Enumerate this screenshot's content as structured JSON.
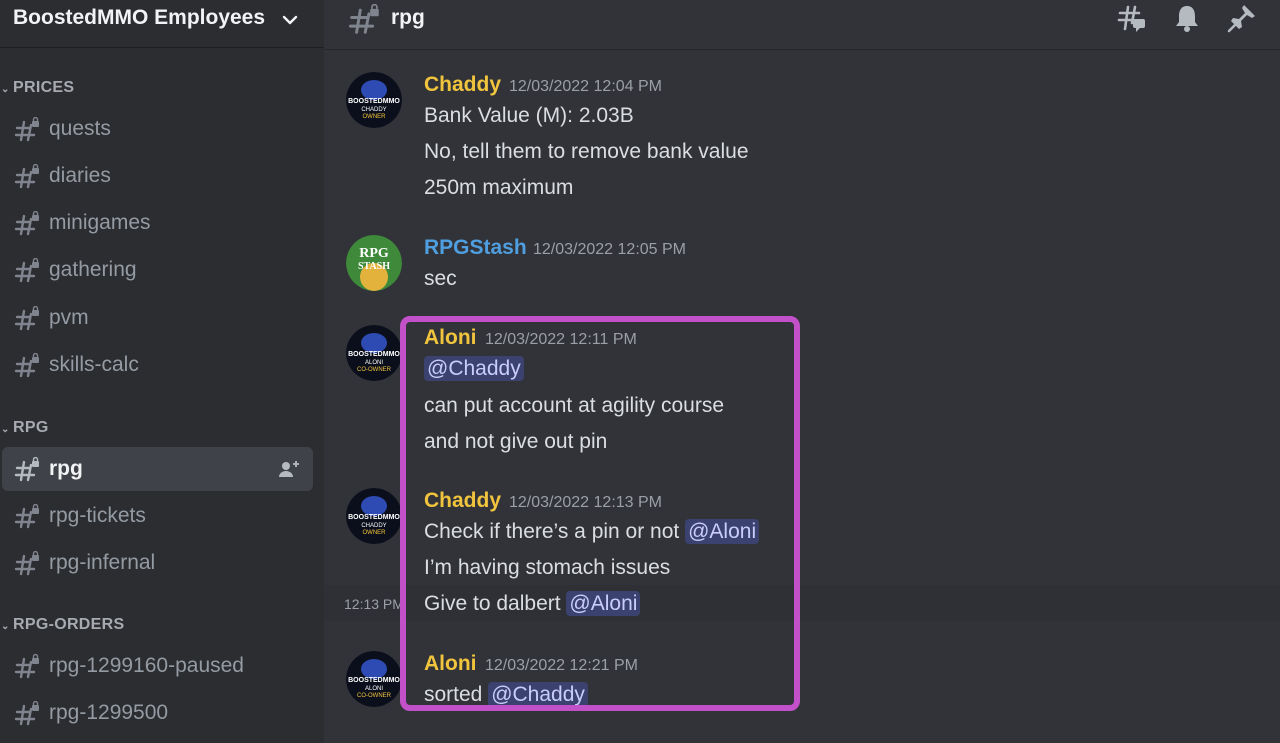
{
  "server": {
    "name": "BoostedMMO Employees"
  },
  "sidebar": {
    "categories": [
      {
        "name": "PRICES",
        "channels": [
          "quests",
          "diaries",
          "minigames",
          "gathering",
          "pvm",
          "skills-calc"
        ]
      },
      {
        "name": "RPG",
        "channels": [
          "rpg",
          "rpg-tickets",
          "rpg-infernal"
        ]
      },
      {
        "name": "RPG-ORDERS",
        "channels": [
          "rpg-1299160-paused",
          "rpg-1299500"
        ]
      }
    ],
    "active_channel": "rpg"
  },
  "header": {
    "channel_name": "rpg",
    "icons": [
      "threads-icon",
      "bell-icon",
      "pin-icon"
    ]
  },
  "messages": [
    {
      "author": "Chaddy",
      "author_color": "#f0c43c",
      "timestamp": "12/03/2022 12:04 PM",
      "avatar_text": [
        "BOOSTEDMMO",
        "CHADDY",
        "OWNER"
      ],
      "lines": [
        "Bank Value (M): 2.03B",
        "No, tell them to remove bank value",
        "250m maximum"
      ]
    },
    {
      "author": "RPGStash",
      "author_color": "#4f9fe0",
      "timestamp": "12/03/2022 12:05 PM",
      "avatar_text": [
        "RPG",
        "STASH"
      ],
      "lines": [
        "sec"
      ]
    },
    {
      "author": "Aloni",
      "author_color": "#f0c43c",
      "timestamp": "12/03/2022 12:11 PM",
      "avatar_text": [
        "BOOSTEDMMO",
        "ALONI",
        "CO-OWNER"
      ],
      "lines": [
        "@Chaddy",
        "can put account at agility course",
        "and not give out pin"
      ]
    },
    {
      "author": "Chaddy",
      "author_color": "#f0c43c",
      "timestamp": "12/03/2022 12:13 PM",
      "avatar_text": [
        "BOOSTEDMMO",
        "CHADDY",
        "OWNER"
      ],
      "lines": [
        "Check if there’s a pin or not ",
        "@Aloni",
        "I’m having stomach issues",
        "Give to dalbert ",
        "@Aloni"
      ]
    },
    {
      "author": "Aloni",
      "author_color": "#f0c43c",
      "timestamp": "12/03/2022 12:21 PM",
      "avatar_text": [
        "BOOSTEDMMO",
        "ALONI",
        "CO-OWNER"
      ],
      "lines": [
        "sorted ",
        "@Chaddy"
      ]
    }
  ],
  "hover_time": "12:13 PM",
  "colors": {
    "highlight_border": "#c150c9",
    "mention_bg": "#3c4270"
  }
}
